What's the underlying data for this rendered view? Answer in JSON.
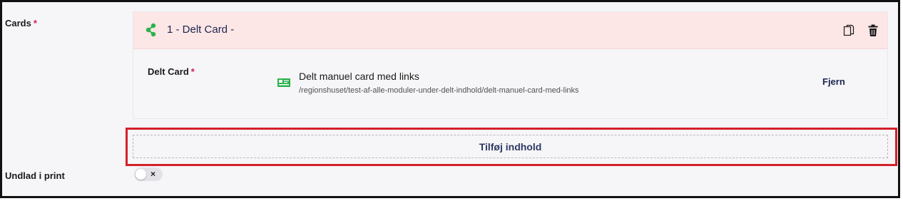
{
  "cards_field": {
    "label": "Cards",
    "required_mark": "*"
  },
  "card": {
    "title": "1 - Delt Card -",
    "field_label": "Delt Card",
    "required_mark": "*",
    "node_name": "Delt manuel card med links",
    "node_url": "/regionshuset/test-af-alle-moduler-under-delt-indhold/delt-manuel-card-med-links",
    "remove_label": "Fjern",
    "icons": {
      "share": "share-icon",
      "copy": "copy-icon",
      "delete": "trash-icon",
      "node": "card-node-icon"
    }
  },
  "add_content_label": "Tilføj indhold",
  "exclude_print": {
    "label": "Undlad i print",
    "toggle_symbol": "×",
    "enabled": false
  },
  "colors": {
    "header_bg": "#fde6e6",
    "accent_green": "#2bb24c",
    "highlight_red": "#d4202b",
    "required_red": "#d42054",
    "text_navy": "#1b264f"
  }
}
